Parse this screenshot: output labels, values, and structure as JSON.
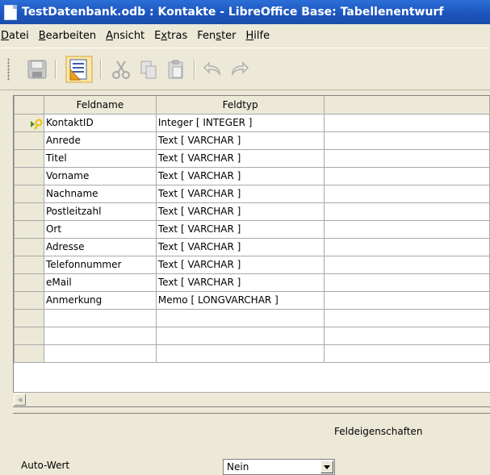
{
  "window": {
    "title": "TestDatenbank.odb : Kontakte - LibreOffice Base: Tabellenentwurf"
  },
  "menu": [
    {
      "pre": "",
      "mn": "D",
      "post": "atei"
    },
    {
      "pre": "",
      "mn": "B",
      "post": "earbeiten"
    },
    {
      "pre": "",
      "mn": "A",
      "post": "nsicht"
    },
    {
      "pre": "E",
      "mn": "x",
      "post": "tras"
    },
    {
      "pre": "Fen",
      "mn": "s",
      "post": "ter"
    },
    {
      "pre": "",
      "mn": "H",
      "post": "ilfe"
    }
  ],
  "toolbar": {
    "icons": [
      "save-icon",
      "design-view-icon",
      "cut-icon",
      "copy-icon",
      "paste-icon",
      "undo-icon",
      "redo-icon"
    ]
  },
  "grid": {
    "headers": {
      "fieldname": "Feldname",
      "fieldtype": "Feldtyp",
      "description": ""
    },
    "rows": [
      {
        "name": "KontaktID",
        "type": "Integer [ INTEGER ]",
        "primary_key": true
      },
      {
        "name": "Anrede",
        "type": "Text [ VARCHAR ]"
      },
      {
        "name": "Titel",
        "type": "Text [ VARCHAR ]"
      },
      {
        "name": "Vorname",
        "type": "Text [ VARCHAR ]"
      },
      {
        "name": "Nachname",
        "type": "Text [ VARCHAR ]"
      },
      {
        "name": "Postleitzahl",
        "type": "Text [ VARCHAR ]"
      },
      {
        "name": "Ort",
        "type": "Text [ VARCHAR ]"
      },
      {
        "name": "Adresse",
        "type": "Text [ VARCHAR ]"
      },
      {
        "name": "Telefonnummer",
        "type": "Text [ VARCHAR ]"
      },
      {
        "name": "eMail",
        "type": "Text [ VARCHAR ]"
      },
      {
        "name": "Anmerkung",
        "type": "Memo [ LONGVARCHAR ]"
      }
    ],
    "empty_rows": 3
  },
  "properties": {
    "title": "Feldeigenschaften",
    "auto_value_label": "Auto-Wert",
    "auto_value_value": "Nein"
  },
  "colors": {
    "titlebar": "#1d55bf",
    "chrome": "#ece9d8",
    "key_icon": "#e8c200"
  }
}
